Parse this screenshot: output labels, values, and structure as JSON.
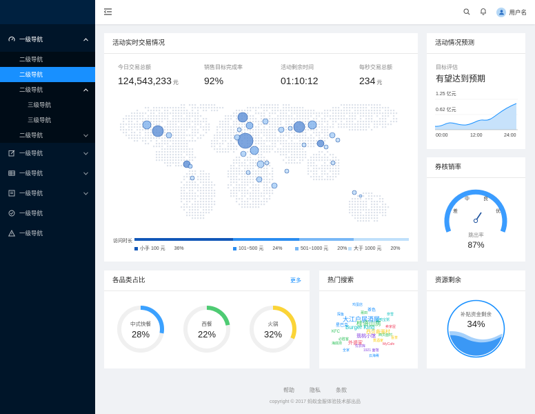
{
  "sidebar": {
    "items": [
      {
        "label": "一级导航",
        "icon": "dashboard-icon"
      },
      {
        "label": "二级导航"
      },
      {
        "label": "二级导航"
      },
      {
        "label": "二级导航"
      },
      {
        "label": "三级导航"
      },
      {
        "label": "三级导航"
      },
      {
        "label": "二级导航"
      },
      {
        "label": "一级导航",
        "icon": "form-icon"
      },
      {
        "label": "一级导航",
        "icon": "table-icon"
      },
      {
        "label": "一级导航",
        "icon": "profile-icon"
      },
      {
        "label": "一级导航",
        "icon": "check-circle-icon"
      },
      {
        "label": "一级导航",
        "icon": "warning-icon"
      }
    ]
  },
  "header": {
    "username": "用户名"
  },
  "realtime": {
    "title": "活动实时交易情况",
    "stats": [
      {
        "label": "今日交易总额",
        "value": "124,543,233",
        "unit": "元"
      },
      {
        "label": "销售目标完成率",
        "value": "92%",
        "unit": ""
      },
      {
        "label": "活动剩余时间",
        "value": "01:10:12",
        "unit": ""
      },
      {
        "label": "每秒交易总额",
        "value": "234",
        "unit": "元"
      }
    ],
    "legend_title": "访问时长",
    "legend": [
      {
        "label": "小手 100 元",
        "pct": "36%",
        "color": "#1257b8"
      },
      {
        "label": "101~500 元",
        "pct": "24%",
        "color": "#2a8cf0"
      },
      {
        "label": "501~1000 元",
        "pct": "20%",
        "color": "#78b8f6"
      },
      {
        "label": "大于 1000 元",
        "pct": "20%",
        "color": "#bfe0fb"
      }
    ]
  },
  "forecast": {
    "title": "活动情况预测",
    "label": "目标评估",
    "value": "有望达到预期",
    "y_ticks": [
      "1.25 亿元",
      "0.62 亿元"
    ],
    "x_ticks": [
      "00:00",
      "12:00",
      "24:00"
    ]
  },
  "ticket": {
    "title": "券核销率",
    "gauge_labels": [
      "中",
      "良",
      "差",
      "优"
    ],
    "caption": "跳出率",
    "value": "87%",
    "level": 0.87
  },
  "categories": {
    "title": "各品类占比",
    "more": "更多",
    "items": [
      {
        "label": "中式快餐",
        "value": "28%",
        "pct": 0.28,
        "color": "#3ba1ff"
      },
      {
        "label": "西餐",
        "value": "22%",
        "pct": 0.22,
        "color": "#4ecb73"
      },
      {
        "label": "火锅",
        "value": "32%",
        "pct": 0.32,
        "color": "#fbd437"
      }
    ]
  },
  "hot": {
    "title": "热门搜索",
    "words": [
      "大江户居酒屋",
      "桂语山房",
      "Burger King",
      "西贝莜面村",
      "翡桃小馆",
      "外婆家",
      "星巴克",
      "KFC",
      "茶色",
      "必胜客",
      "小鸭宝粥",
      "蒸酒家",
      "优衣库",
      "卖家屋",
      "全家",
      "西贝面村",
      "鸡蛋店",
      "海底捞",
      "奈雪",
      "喜茶",
      "1921 面馆",
      "MyCafe",
      "探鱼",
      "莆田",
      "云海肴"
    ]
  },
  "resource": {
    "title": "资源剩余",
    "label": "补贴资金剩余",
    "value": "34%",
    "level": 0.34
  },
  "footer": {
    "links": [
      "帮助",
      "隐私",
      "条款"
    ],
    "copyright": "copyright © 2017 蚂蚁金服体验技术部出品"
  }
}
